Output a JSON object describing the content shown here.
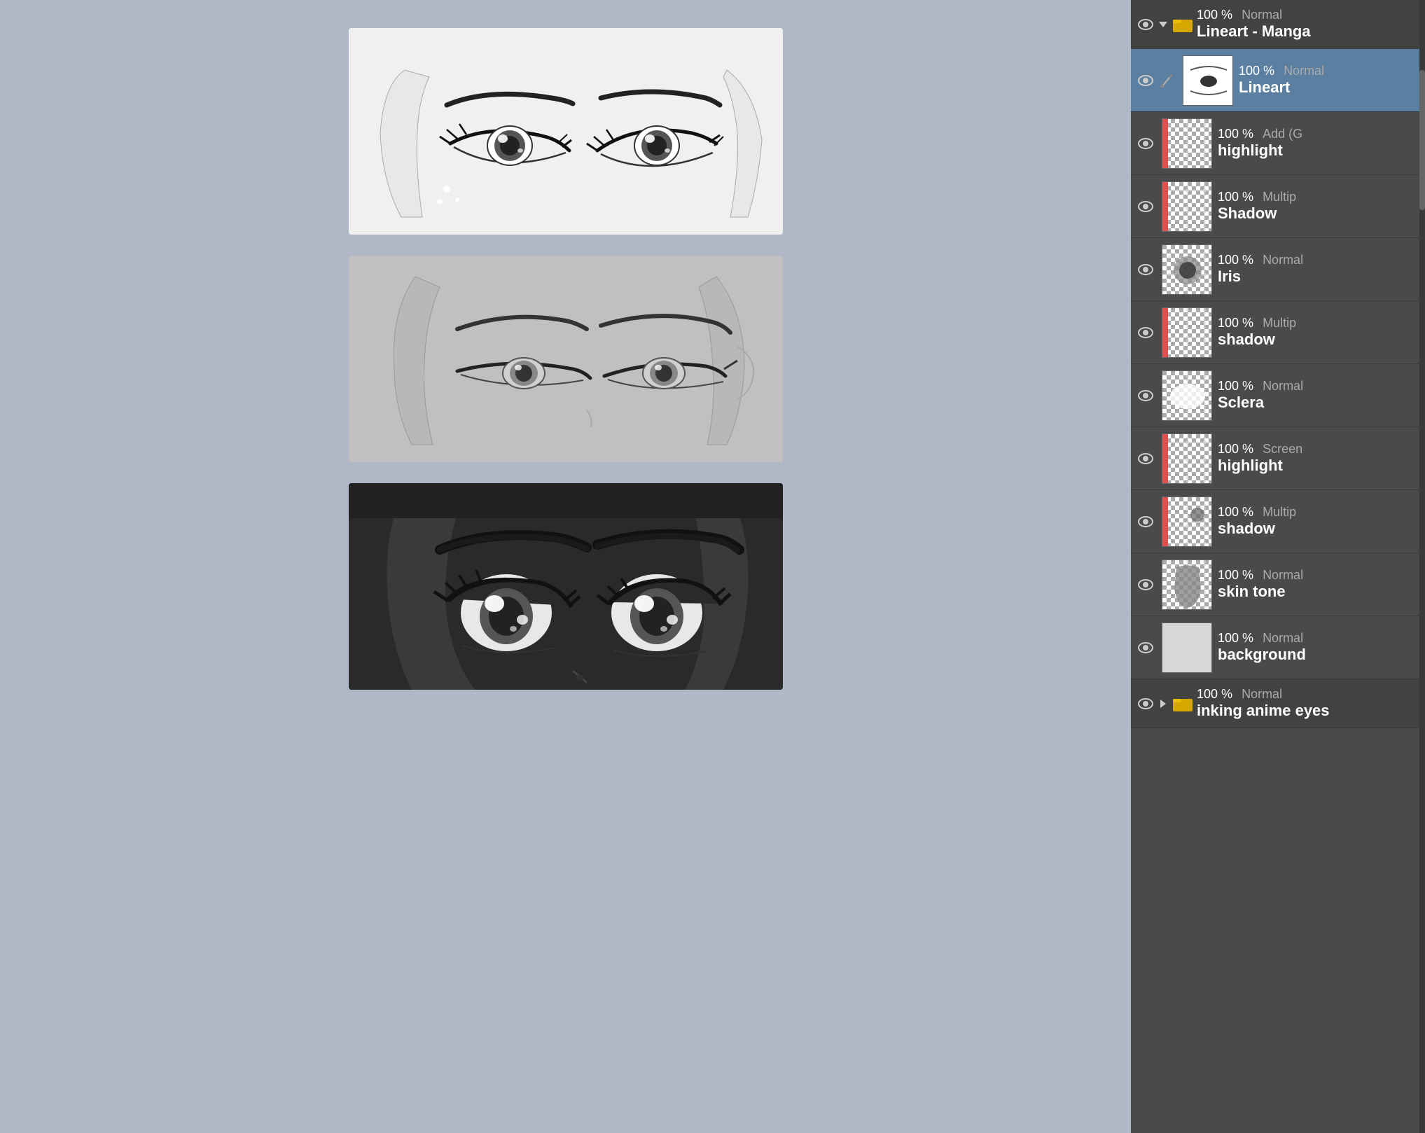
{
  "canvas": {
    "panels": [
      {
        "id": "top",
        "label": "Manga lineart panel - light background"
      },
      {
        "id": "mid",
        "label": "Manga panel - medium gray background"
      },
      {
        "id": "bot",
        "label": "Manga panel - dark background"
      }
    ]
  },
  "layers": {
    "items": [
      {
        "id": "group-lineart-manga",
        "type": "group-header",
        "opacity": "100 %",
        "blend": "Normal",
        "name": "Lineart - Manga",
        "has_arrow": true,
        "arrow_direction": "down",
        "has_folder": true
      },
      {
        "id": "lineart",
        "type": "layer",
        "selected": true,
        "has_brush": true,
        "opacity": "100 %",
        "blend": "Normal",
        "name": "Lineart"
      },
      {
        "id": "highlight",
        "type": "layer",
        "selected": false,
        "has_red_bar": true,
        "opacity": "100 %",
        "blend": "Add (G",
        "name": "highlight"
      },
      {
        "id": "shadow1",
        "type": "layer",
        "selected": false,
        "has_red_bar": true,
        "opacity": "100 %",
        "blend": "Multip",
        "name": "Shadow"
      },
      {
        "id": "iris",
        "type": "layer",
        "selected": false,
        "has_red_bar": false,
        "opacity": "100 %",
        "blend": "Normal",
        "name": "Iris"
      },
      {
        "id": "shadow2",
        "type": "layer",
        "selected": false,
        "has_red_bar": true,
        "opacity": "100 %",
        "blend": "Multip",
        "name": "shadow"
      },
      {
        "id": "sclera",
        "type": "layer",
        "selected": false,
        "has_red_bar": false,
        "opacity": "100 %",
        "blend": "Normal",
        "name": "Sclera"
      },
      {
        "id": "highlight2",
        "type": "layer",
        "selected": false,
        "has_red_bar": true,
        "opacity": "100 %",
        "blend": "Screen",
        "name": "highlight"
      },
      {
        "id": "shadow3",
        "type": "layer",
        "selected": false,
        "has_red_bar": true,
        "opacity": "100 %",
        "blend": "Multip",
        "name": "shadow"
      },
      {
        "id": "skin-tone",
        "type": "layer",
        "selected": false,
        "has_red_bar": false,
        "opacity": "100 %",
        "blend": "Normal",
        "name": "skin tone"
      },
      {
        "id": "background",
        "type": "layer",
        "selected": false,
        "has_red_bar": false,
        "white_thumb": true,
        "opacity": "100 %",
        "blend": "Normal",
        "name": "background"
      },
      {
        "id": "group-inking",
        "type": "group-footer",
        "opacity": "100 %",
        "blend": "Normal",
        "name": "inking anime eyes",
        "has_arrow": true,
        "arrow_direction": "right",
        "has_folder": true
      }
    ]
  }
}
